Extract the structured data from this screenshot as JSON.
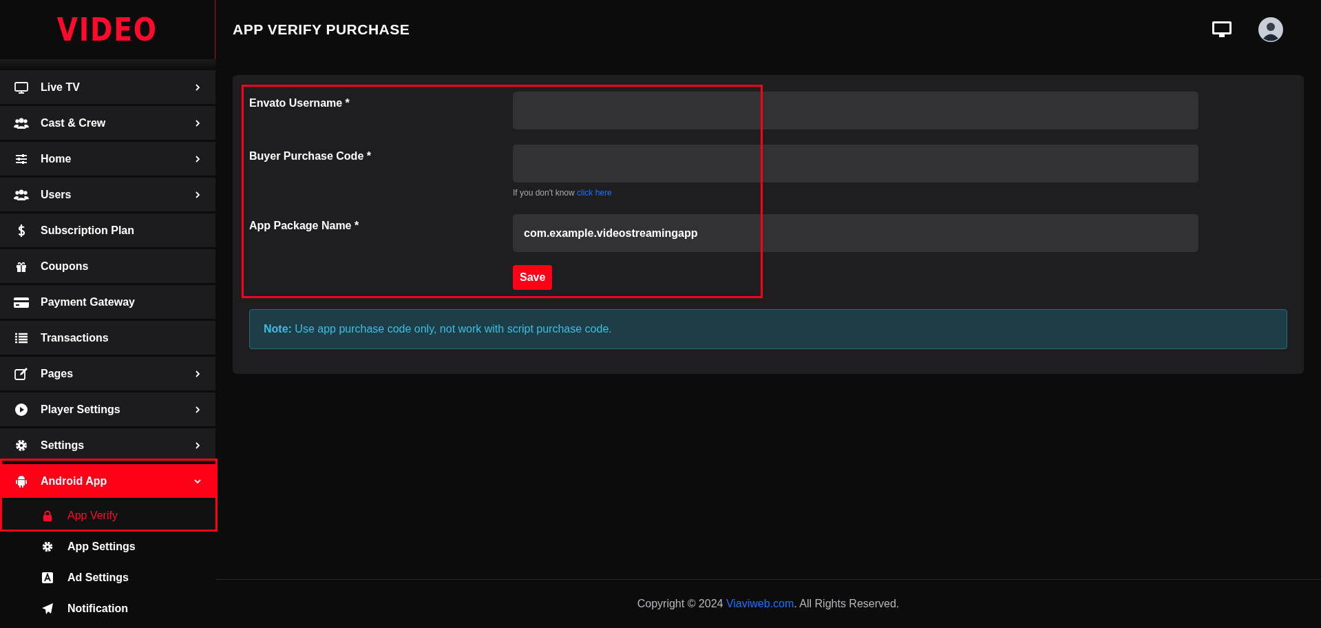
{
  "header": {
    "logo": "VIDEO",
    "title": "APP VERIFY PURCHASE"
  },
  "sidebar": {
    "items": [
      {
        "label": "Live TV",
        "has_submenu": true,
        "expanded": false,
        "selected": false,
        "highlighted": false
      },
      {
        "label": "Cast & Crew",
        "has_submenu": true,
        "expanded": false,
        "selected": false,
        "highlighted": false
      },
      {
        "label": "Home",
        "has_submenu": true,
        "expanded": false,
        "selected": false,
        "highlighted": false
      },
      {
        "label": "Users",
        "has_submenu": true,
        "expanded": false,
        "selected": false,
        "highlighted": false
      },
      {
        "label": "Subscription Plan",
        "has_submenu": false,
        "selected": false,
        "highlighted": false
      },
      {
        "label": "Coupons",
        "has_submenu": false,
        "selected": false,
        "highlighted": false
      },
      {
        "label": "Payment Gateway",
        "has_submenu": false,
        "selected": false,
        "highlighted": false
      },
      {
        "label": "Transactions",
        "has_submenu": false,
        "selected": false,
        "highlighted": false
      },
      {
        "label": "Pages",
        "has_submenu": true,
        "expanded": false,
        "selected": false,
        "highlighted": false
      },
      {
        "label": "Player Settings",
        "has_submenu": true,
        "expanded": false,
        "selected": false,
        "highlighted": false
      },
      {
        "label": "Settings",
        "has_submenu": true,
        "expanded": false,
        "selected": false,
        "highlighted": false
      },
      {
        "label": "Android App",
        "has_submenu": true,
        "expanded": true,
        "selected": true,
        "highlighted": true,
        "children": [
          {
            "label": "App Verify",
            "selected": true
          },
          {
            "label": "App Settings",
            "selected": false
          },
          {
            "label": "Ad Settings",
            "selected": false
          },
          {
            "label": "Notification",
            "selected": false
          }
        ]
      }
    ]
  },
  "form": {
    "highlighted": true,
    "fields": [
      {
        "label": "Envato Username *"
      },
      {
        "label": "Buyer Purchase Code *",
        "help": {
          "text": "If you don't know",
          "link": "click here"
        }
      },
      {
        "label": "App Package Name *",
        "value": "com.example.videostreamingapp"
      }
    ],
    "button": "Save"
  },
  "note": "**Note:** Use app purchase code only, not work with script purchase code.",
  "footer": {
    "text_before": "Copyright © 2024",
    "link": "Viaviweb.com",
    "text_after": ". All Rights Reserved."
  }
}
